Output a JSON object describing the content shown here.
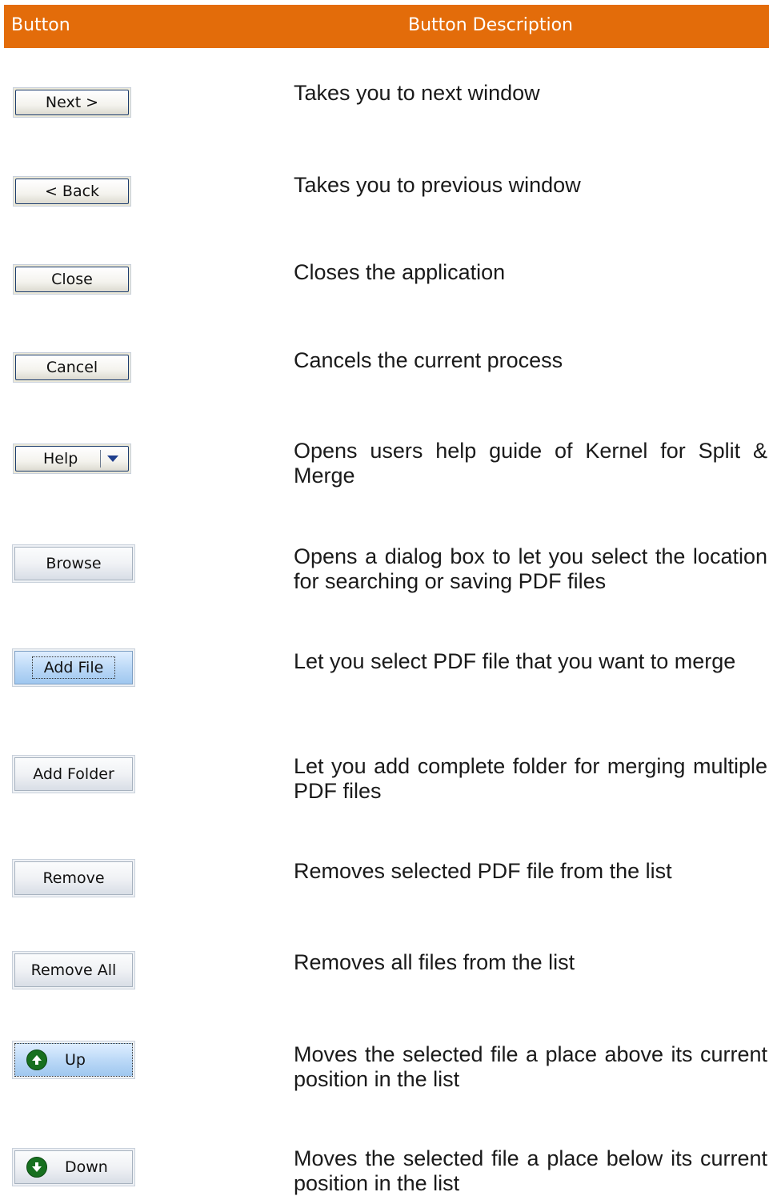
{
  "header": {
    "col1": "Button",
    "col2": "Button Description",
    "color": "#e36c0a"
  },
  "rows": [
    {
      "button": "Next >",
      "description": "Takes you to next window"
    },
    {
      "button": "< Back",
      "description": "Takes you to previous window"
    },
    {
      "button": "Close",
      "description": "Closes the application"
    },
    {
      "button": "Cancel",
      "description": "Cancels the current process"
    },
    {
      "button": "Help",
      "description": "Opens users help guide of Kernel for Split & Merge"
    },
    {
      "button": "Browse",
      "description": "Opens a dialog box to let you select the location for searching or saving PDF files"
    },
    {
      "button": "Add File",
      "description": "Let you select PDF file that you want to merge"
    },
    {
      "button": "Add Folder",
      "description": "Let you add complete folder for merging multiple PDF files"
    },
    {
      "button": "Remove",
      "description": "Removes selected PDF file from the list"
    },
    {
      "button": "Remove All",
      "description": "Removes all files from the list"
    },
    {
      "button": "Up",
      "icon": "arrow-up-icon",
      "description": "Moves the selected file a place above its current position in the list"
    },
    {
      "button": "Down",
      "icon": "arrow-down-icon",
      "description": "Moves the selected file a place below its current position in the list"
    }
  ]
}
